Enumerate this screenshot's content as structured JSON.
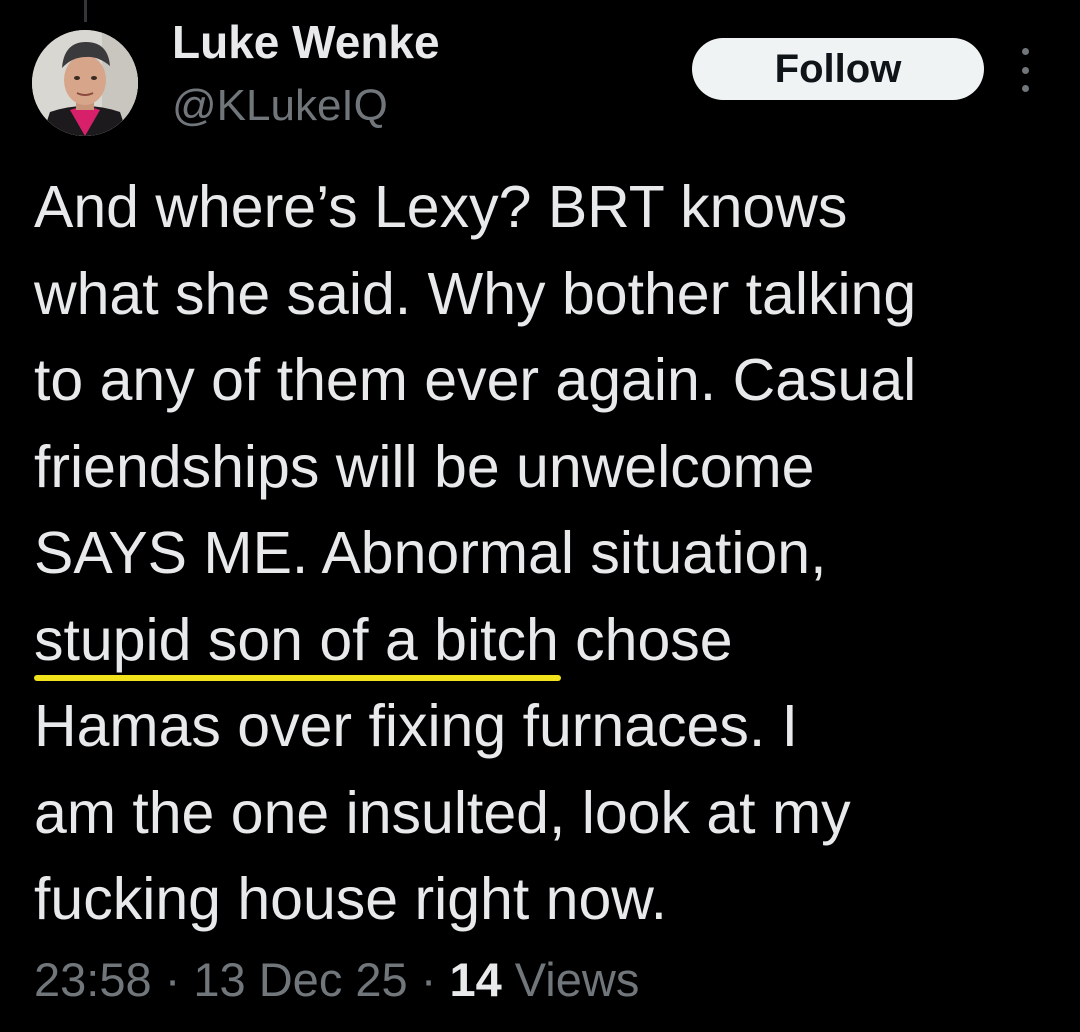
{
  "author": {
    "name": "Luke Wenke",
    "handle": "@KLukeIQ"
  },
  "follow_button": {
    "label": "Follow"
  },
  "more_menu": {
    "icon": "more-vertical-icon"
  },
  "tweet": {
    "lines": [
      "And where’s Lexy?  BRT knows",
      "what she said.  Why bother talking",
      "to any of them ever again.  Casual",
      "friendships will be unwelcome",
      "SAYS ME.  Abnormal situation,"
    ],
    "line6_highlighted": "stupid son of a bitch",
    "line6_rest": " chose",
    "lines_after": [
      "Hamas over fixing furnaces.  I",
      "am the one insulted, look at my",
      "fucking house right now."
    ]
  },
  "meta": {
    "time": "23:58",
    "separator": "·",
    "date": "13 Dec 25",
    "views_count": "14",
    "views_label": "Views"
  },
  "colors": {
    "background": "#000000",
    "text_primary": "#e7e9ea",
    "text_secondary": "#71767b",
    "follow_bg": "#eff3f4",
    "highlight_underline": "#f2e21b"
  }
}
